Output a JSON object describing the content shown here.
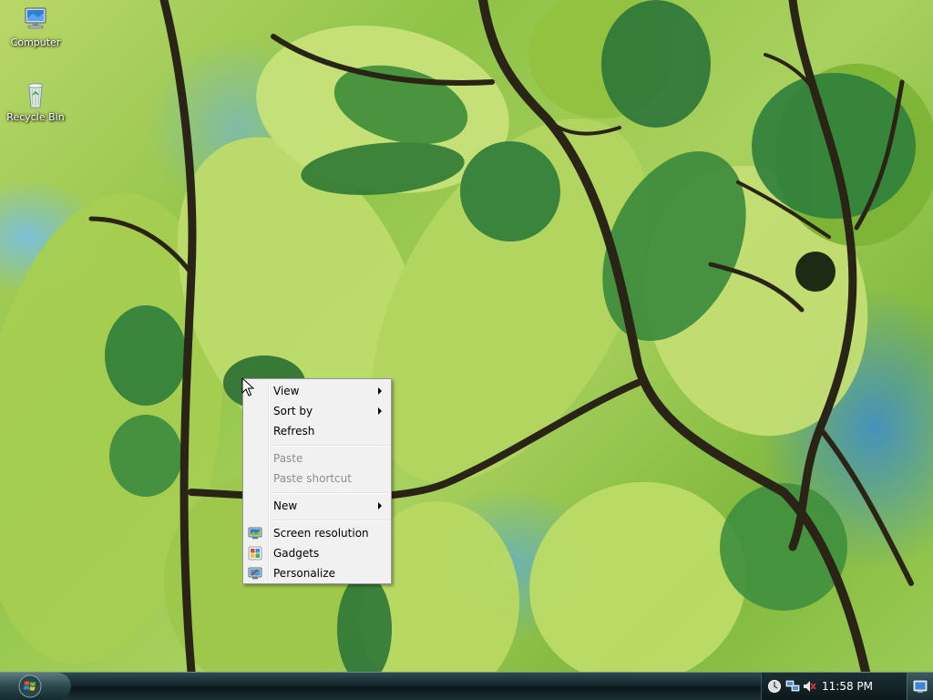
{
  "desktop": {
    "icons": [
      {
        "label": "Computer",
        "icon": "computer-icon"
      },
      {
        "label": "Recycle Bin",
        "icon": "recycle-bin-icon"
      }
    ]
  },
  "context_menu": {
    "items": [
      {
        "label": "View",
        "has_submenu": true,
        "enabled": true
      },
      {
        "label": "Sort by",
        "has_submenu": true,
        "enabled": true
      },
      {
        "label": "Refresh",
        "has_submenu": false,
        "enabled": true
      },
      {
        "label": "Paste",
        "has_submenu": false,
        "enabled": false
      },
      {
        "label": "Paste shortcut",
        "has_submenu": false,
        "enabled": false
      },
      {
        "label": "New",
        "has_submenu": true,
        "enabled": true
      },
      {
        "label": "Screen resolution",
        "icon": "screen-resolution-icon",
        "enabled": true
      },
      {
        "label": "Gadgets",
        "icon": "gadgets-icon",
        "enabled": true
      },
      {
        "label": "Personalize",
        "icon": "personalize-icon",
        "enabled": true
      }
    ]
  },
  "taskbar": {
    "start_icon": "windows-logo-icon",
    "tray_icons": [
      "action-center-icon",
      "network-icon",
      "volume-muted-icon"
    ],
    "clock": "11:58 PM",
    "show_desktop_icon": "show-desktop-icon"
  },
  "colors": {
    "menu_background": "#f1f1f1",
    "menu_border": "#979797",
    "disabled_text": "#8d8d8d",
    "taskbar": "#14262a"
  }
}
